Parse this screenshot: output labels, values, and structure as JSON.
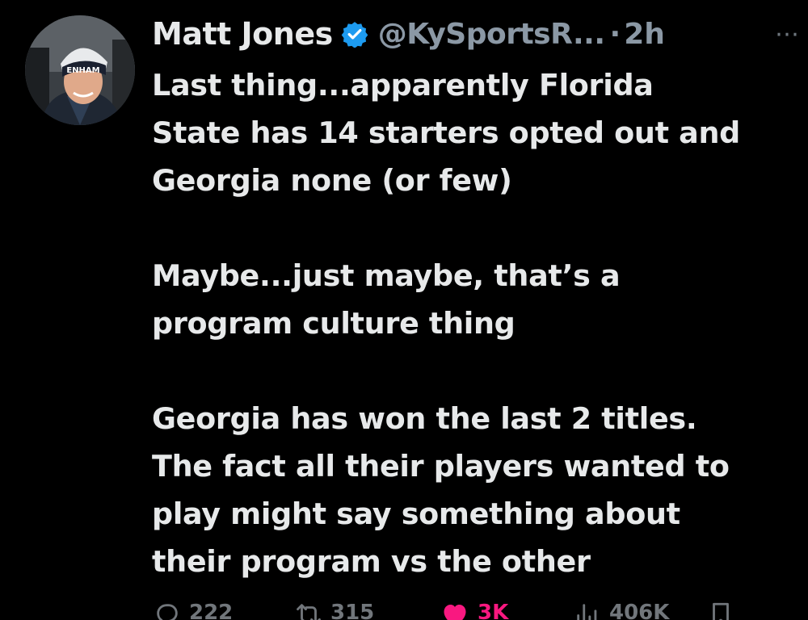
{
  "author": {
    "name": "Matt Jones",
    "handle": "@KySportsR...",
    "separator": "·",
    "time": "2h",
    "verified": true,
    "avatar_beanie_text": "ENHAM"
  },
  "more_icon": "⋯",
  "tweet": {
    "paragraphs": [
      {
        "lines": [
          "Last thing...apparently Florida",
          "State has 14 starters opted out and",
          "Georgia none (or few)"
        ]
      },
      {
        "lines": [
          "Maybe...just maybe, that’s a",
          "program culture thing"
        ]
      },
      {
        "lines": [
          "Georgia has won the last 2 titles.",
          "The fact all their players wanted to",
          "play might say something about",
          "their program vs the other"
        ]
      }
    ]
  },
  "actions": {
    "replies": "222",
    "reposts": "315",
    "likes": "3K",
    "views": "406K"
  },
  "colors": {
    "background": "#000000",
    "text": "#e7e9ea",
    "muted": "#8b98a5",
    "verified": "#1d9bf0",
    "like": "#f91880"
  },
  "icons": [
    "verified-badge-icon",
    "more-icon",
    "reply-icon",
    "repost-icon",
    "like-icon",
    "views-icon",
    "bookmark-icon"
  ]
}
